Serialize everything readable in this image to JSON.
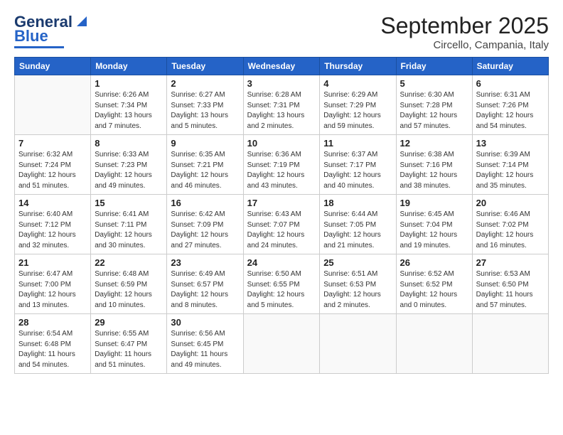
{
  "header": {
    "logo_general": "General",
    "logo_blue": "Blue",
    "month_title": "September 2025",
    "location": "Circello, Campania, Italy"
  },
  "days_of_week": [
    "Sunday",
    "Monday",
    "Tuesday",
    "Wednesday",
    "Thursday",
    "Friday",
    "Saturday"
  ],
  "weeks": [
    [
      {
        "num": "",
        "detail": ""
      },
      {
        "num": "1",
        "detail": "Sunrise: 6:26 AM\nSunset: 7:34 PM\nDaylight: 13 hours\nand 7 minutes."
      },
      {
        "num": "2",
        "detail": "Sunrise: 6:27 AM\nSunset: 7:33 PM\nDaylight: 13 hours\nand 5 minutes."
      },
      {
        "num": "3",
        "detail": "Sunrise: 6:28 AM\nSunset: 7:31 PM\nDaylight: 13 hours\nand 2 minutes."
      },
      {
        "num": "4",
        "detail": "Sunrise: 6:29 AM\nSunset: 7:29 PM\nDaylight: 12 hours\nand 59 minutes."
      },
      {
        "num": "5",
        "detail": "Sunrise: 6:30 AM\nSunset: 7:28 PM\nDaylight: 12 hours\nand 57 minutes."
      },
      {
        "num": "6",
        "detail": "Sunrise: 6:31 AM\nSunset: 7:26 PM\nDaylight: 12 hours\nand 54 minutes."
      }
    ],
    [
      {
        "num": "7",
        "detail": "Sunrise: 6:32 AM\nSunset: 7:24 PM\nDaylight: 12 hours\nand 51 minutes."
      },
      {
        "num": "8",
        "detail": "Sunrise: 6:33 AM\nSunset: 7:23 PM\nDaylight: 12 hours\nand 49 minutes."
      },
      {
        "num": "9",
        "detail": "Sunrise: 6:35 AM\nSunset: 7:21 PM\nDaylight: 12 hours\nand 46 minutes."
      },
      {
        "num": "10",
        "detail": "Sunrise: 6:36 AM\nSunset: 7:19 PM\nDaylight: 12 hours\nand 43 minutes."
      },
      {
        "num": "11",
        "detail": "Sunrise: 6:37 AM\nSunset: 7:17 PM\nDaylight: 12 hours\nand 40 minutes."
      },
      {
        "num": "12",
        "detail": "Sunrise: 6:38 AM\nSunset: 7:16 PM\nDaylight: 12 hours\nand 38 minutes."
      },
      {
        "num": "13",
        "detail": "Sunrise: 6:39 AM\nSunset: 7:14 PM\nDaylight: 12 hours\nand 35 minutes."
      }
    ],
    [
      {
        "num": "14",
        "detail": "Sunrise: 6:40 AM\nSunset: 7:12 PM\nDaylight: 12 hours\nand 32 minutes."
      },
      {
        "num": "15",
        "detail": "Sunrise: 6:41 AM\nSunset: 7:11 PM\nDaylight: 12 hours\nand 30 minutes."
      },
      {
        "num": "16",
        "detail": "Sunrise: 6:42 AM\nSunset: 7:09 PM\nDaylight: 12 hours\nand 27 minutes."
      },
      {
        "num": "17",
        "detail": "Sunrise: 6:43 AM\nSunset: 7:07 PM\nDaylight: 12 hours\nand 24 minutes."
      },
      {
        "num": "18",
        "detail": "Sunrise: 6:44 AM\nSunset: 7:05 PM\nDaylight: 12 hours\nand 21 minutes."
      },
      {
        "num": "19",
        "detail": "Sunrise: 6:45 AM\nSunset: 7:04 PM\nDaylight: 12 hours\nand 19 minutes."
      },
      {
        "num": "20",
        "detail": "Sunrise: 6:46 AM\nSunset: 7:02 PM\nDaylight: 12 hours\nand 16 minutes."
      }
    ],
    [
      {
        "num": "21",
        "detail": "Sunrise: 6:47 AM\nSunset: 7:00 PM\nDaylight: 12 hours\nand 13 minutes."
      },
      {
        "num": "22",
        "detail": "Sunrise: 6:48 AM\nSunset: 6:59 PM\nDaylight: 12 hours\nand 10 minutes."
      },
      {
        "num": "23",
        "detail": "Sunrise: 6:49 AM\nSunset: 6:57 PM\nDaylight: 12 hours\nand 8 minutes."
      },
      {
        "num": "24",
        "detail": "Sunrise: 6:50 AM\nSunset: 6:55 PM\nDaylight: 12 hours\nand 5 minutes."
      },
      {
        "num": "25",
        "detail": "Sunrise: 6:51 AM\nSunset: 6:53 PM\nDaylight: 12 hours\nand 2 minutes."
      },
      {
        "num": "26",
        "detail": "Sunrise: 6:52 AM\nSunset: 6:52 PM\nDaylight: 12 hours\nand 0 minutes."
      },
      {
        "num": "27",
        "detail": "Sunrise: 6:53 AM\nSunset: 6:50 PM\nDaylight: 11 hours\nand 57 minutes."
      }
    ],
    [
      {
        "num": "28",
        "detail": "Sunrise: 6:54 AM\nSunset: 6:48 PM\nDaylight: 11 hours\nand 54 minutes."
      },
      {
        "num": "29",
        "detail": "Sunrise: 6:55 AM\nSunset: 6:47 PM\nDaylight: 11 hours\nand 51 minutes."
      },
      {
        "num": "30",
        "detail": "Sunrise: 6:56 AM\nSunset: 6:45 PM\nDaylight: 11 hours\nand 49 minutes."
      },
      {
        "num": "",
        "detail": ""
      },
      {
        "num": "",
        "detail": ""
      },
      {
        "num": "",
        "detail": ""
      },
      {
        "num": "",
        "detail": ""
      }
    ]
  ]
}
